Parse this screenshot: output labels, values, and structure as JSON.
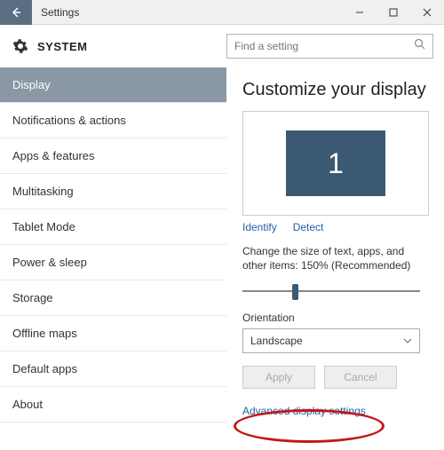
{
  "titlebar": {
    "title": "Settings"
  },
  "header": {
    "system_label": "SYSTEM",
    "search_placeholder": "Find a setting"
  },
  "sidebar": {
    "items": [
      {
        "label": "Display"
      },
      {
        "label": "Notifications & actions"
      },
      {
        "label": "Apps & features"
      },
      {
        "label": "Multitasking"
      },
      {
        "label": "Tablet Mode"
      },
      {
        "label": "Power & sleep"
      },
      {
        "label": "Storage"
      },
      {
        "label": "Offline maps"
      },
      {
        "label": "Default apps"
      },
      {
        "label": "About"
      }
    ]
  },
  "main": {
    "heading": "Customize your display",
    "monitor_number": "1",
    "identify_label": "Identify",
    "detect_label": "Detect",
    "scale_text": "Change the size of text, apps, and other items: 150% (Recommended)",
    "orientation_label": "Orientation",
    "orientation_value": "Landscape",
    "apply_label": "Apply",
    "cancel_label": "Cancel",
    "advanced_link": "Advanced display settings"
  }
}
